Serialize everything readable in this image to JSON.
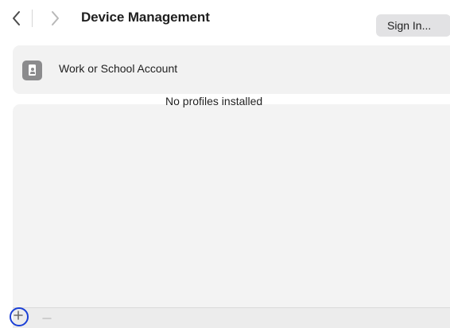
{
  "toolbar": {
    "back_icon": "chevron-left-icon",
    "forward_icon": "chevron-right-icon",
    "title": "Device Management"
  },
  "account": {
    "icon": "id-badge-icon",
    "label": "Work or School Account",
    "sign_in_label": "Sign In..."
  },
  "profiles": {
    "empty_message": "No profiles installed"
  },
  "bottom_bar": {
    "add_icon": "plus-icon",
    "remove_icon": "minus-icon",
    "highlight_color": "#1a3fd6"
  }
}
